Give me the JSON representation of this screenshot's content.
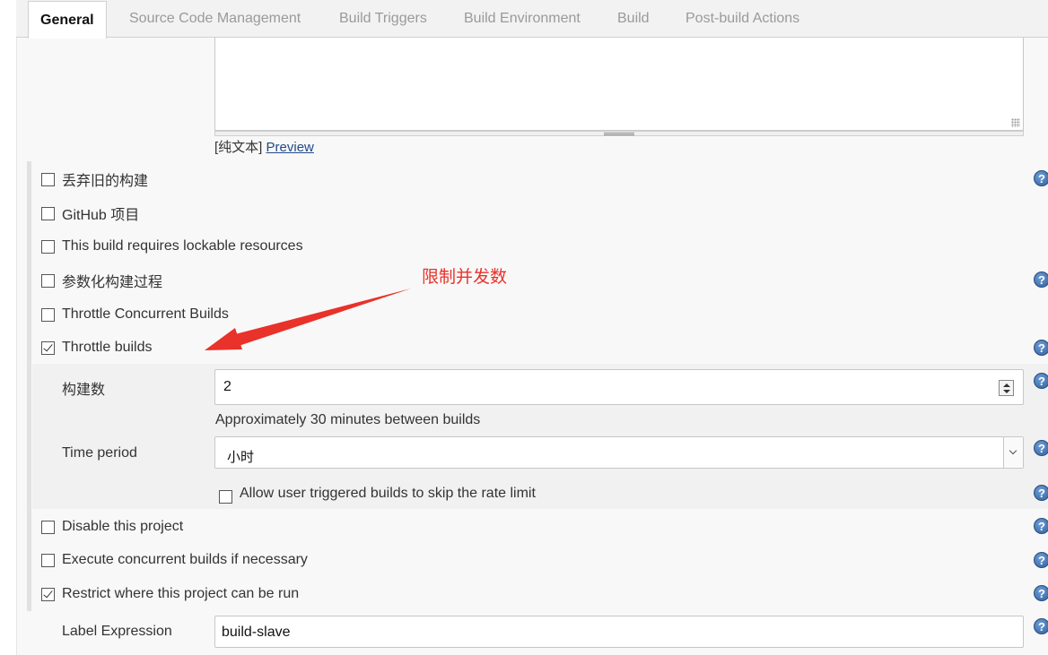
{
  "tabs": [
    {
      "label": "General",
      "active": true
    },
    {
      "label": "Source Code Management"
    },
    {
      "label": "Build Triggers"
    },
    {
      "label": "Build Environment"
    },
    {
      "label": "Build"
    },
    {
      "label": "Post-build Actions"
    }
  ],
  "description": {
    "format_prefix": "[纯文本]",
    "preview_link": "Preview"
  },
  "options": {
    "discard_old_builds": {
      "label": "丢弃旧的构建",
      "checked": false
    },
    "github_project": {
      "label": "GitHub 项目",
      "checked": false
    },
    "lockable_resources": {
      "label": "This build requires lockable resources",
      "checked": false
    },
    "parameterized": {
      "label": "参数化构建过程",
      "checked": false
    },
    "throttle_concurrent": {
      "label": "Throttle Concurrent Builds",
      "checked": false
    },
    "throttle_builds": {
      "label": "Throttle builds",
      "checked": true
    },
    "disable_project": {
      "label": "Disable this project",
      "checked": false
    },
    "concurrent_builds": {
      "label": "Execute concurrent builds if necessary",
      "checked": false
    },
    "restrict_where": {
      "label": "Restrict where this project can be run",
      "checked": true
    }
  },
  "throttle": {
    "build_count_label": "构建数",
    "build_count_value": "2",
    "hint": "Approximately 30 minutes between builds",
    "time_period_label": "Time period",
    "time_period_value": "小时",
    "allow_user_label": "Allow user triggered builds to skip the rate limit",
    "allow_user_checked": false
  },
  "label_expression": {
    "label": "Label Expression",
    "value": "build-slave"
  },
  "annotation": {
    "text": "限制并发数",
    "color": "#e8322a"
  },
  "help_icon": "?",
  "colors": {
    "link": "#204a87",
    "help_icon": "#2f5f9e"
  }
}
